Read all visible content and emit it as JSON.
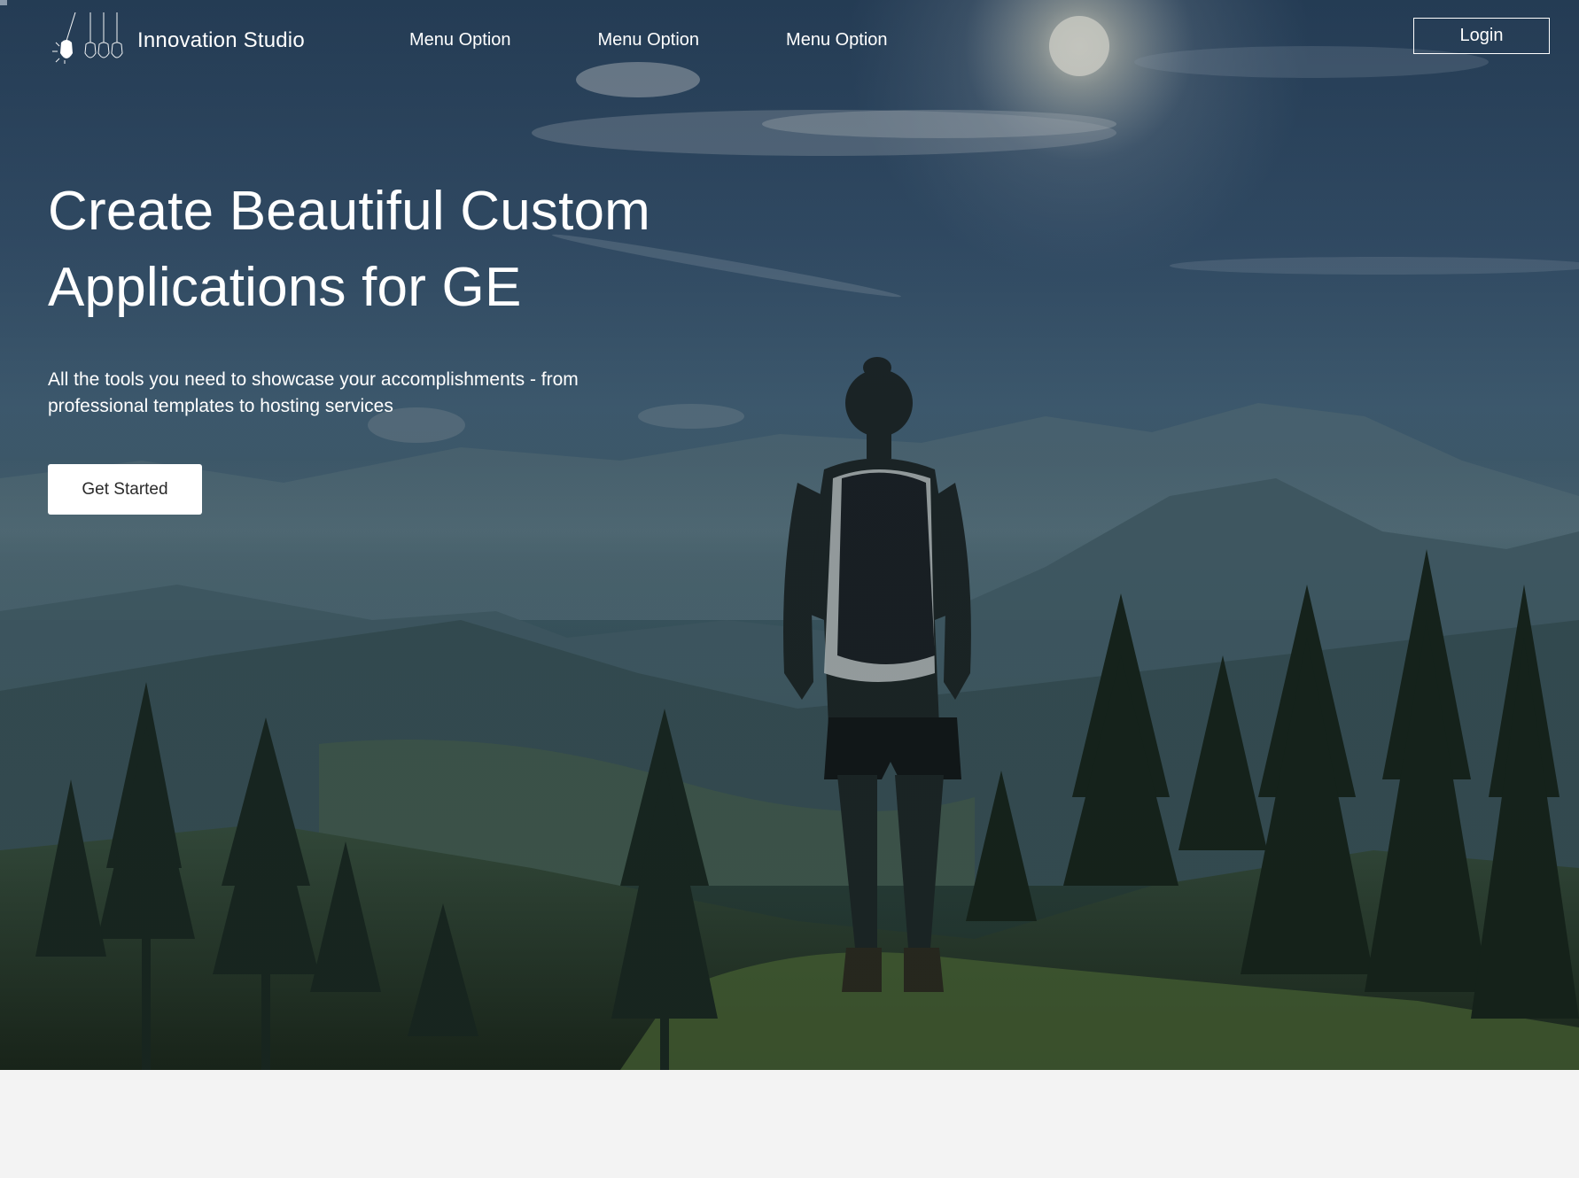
{
  "brand": {
    "name": "Innovation Studio",
    "logo_icon": "lightbulb-pendulum-icon"
  },
  "nav": {
    "items": [
      {
        "label": "Menu Option"
      },
      {
        "label": "Menu Option"
      },
      {
        "label": "Menu Option"
      }
    ],
    "login_label": "Login"
  },
  "hero": {
    "title_line1": "Create Beautiful Custom",
    "title_line2": "Applications for GE",
    "subtitle_line1": "All the tools you need to showcase your accomplishments - from",
    "subtitle_line2": "professional templates to hosting services",
    "cta_label": "Get Started",
    "background": "mountain-hiker-photo"
  },
  "colors": {
    "text": "#ffffff",
    "cta_bg": "#ffffff",
    "cta_text": "#2a2a2a",
    "footer_bg": "#f3f3f3"
  }
}
